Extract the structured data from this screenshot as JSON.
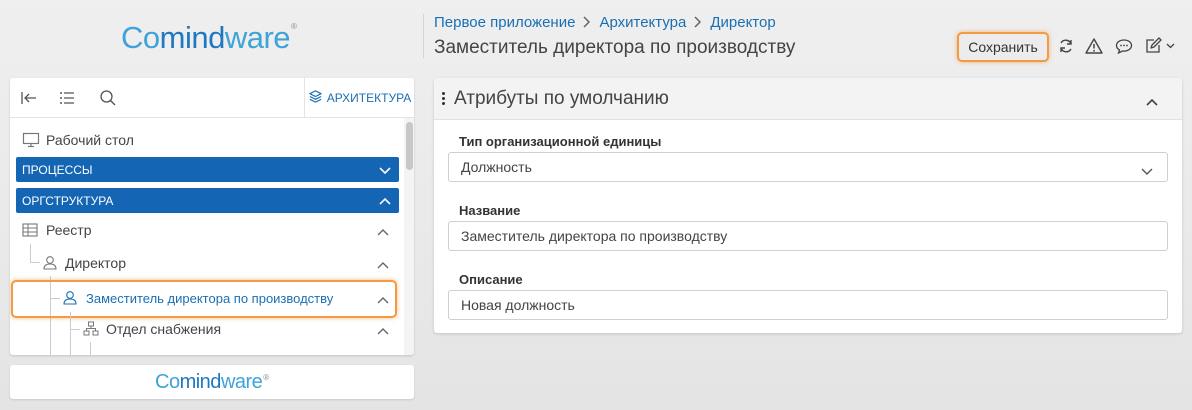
{
  "brand": {
    "co": "Co",
    "mind": "mind",
    "ware": "ware",
    "mark": "®"
  },
  "breadcrumb": [
    "Первое приложение",
    "Архитектура",
    "Директор"
  ],
  "page_title": "Заместитель директора по производству",
  "toolbar": {
    "save_label": "Сохранить"
  },
  "left_panel": {
    "tab_label": "АРХИТЕКТУРА",
    "tree": {
      "desktop": "Рабочий стол",
      "processes": "ПРОЦЕССЫ",
      "orgstructure": "ОРГСТРУКТУРА",
      "registry": "Реестр",
      "director": "Директор",
      "deputy": "Заместитель директора по производству",
      "supply": "Отдел снабжения"
    }
  },
  "card": {
    "title": "Атрибуты по умолчанию",
    "fields": [
      {
        "label": "Тип организационной единицы",
        "value": "Должность"
      },
      {
        "label": "Название",
        "value": "Заместитель директора по производству"
      },
      {
        "label": "Описание",
        "value": "Новая должность"
      }
    ]
  },
  "colors": {
    "accent": "#1565b5",
    "link": "#1a6fb3",
    "highlight": "#f29a44"
  }
}
